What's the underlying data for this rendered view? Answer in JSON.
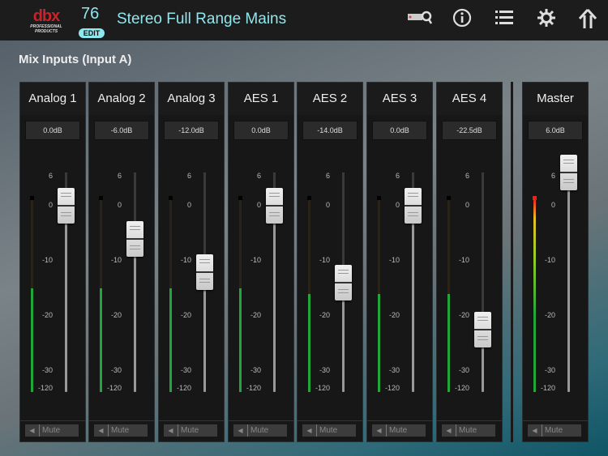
{
  "header": {
    "logo": "dbx",
    "logo_sub": "PROFESSIONAL PRODUCTS",
    "preset_number": "76",
    "edit_label": "EDIT",
    "preset_name": "Stereo Full Range Mains",
    "icons": [
      "device-search-icon",
      "info-icon",
      "list-icon",
      "gear-icon",
      "home-icon"
    ]
  },
  "section_title": "Mix Inputs  (Input A)",
  "scale": [
    "6",
    "0",
    "-10",
    "-20",
    "-30",
    "-120"
  ],
  "mute_label": "Mute",
  "channels": [
    {
      "name": "Analog 1",
      "value_label": "0.0dB",
      "value_db": 0,
      "meter_db": -15,
      "active": true
    },
    {
      "name": "Analog 2",
      "value_label": "-6.0dB",
      "value_db": -6,
      "meter_db": -15,
      "active": true
    },
    {
      "name": "Analog 3",
      "value_label": "-12.0dB",
      "value_db": -12,
      "meter_db": -15,
      "active": true
    },
    {
      "name": "AES 1",
      "value_label": "0.0dB",
      "value_db": 0,
      "meter_db": -15,
      "active": true
    },
    {
      "name": "AES 2",
      "value_label": "-14.0dB",
      "value_db": -14,
      "meter_db": -16,
      "active": true
    },
    {
      "name": "AES 3",
      "value_label": "0.0dB",
      "value_db": 0,
      "meter_db": -16,
      "active": true
    },
    {
      "name": "AES 4",
      "value_label": "-22.5dB",
      "value_db": -22.5,
      "meter_db": -16,
      "active": true
    }
  ],
  "master": {
    "name": "Master",
    "value_label": "6.0dB",
    "value_db": 6,
    "meter_db": 6
  }
}
